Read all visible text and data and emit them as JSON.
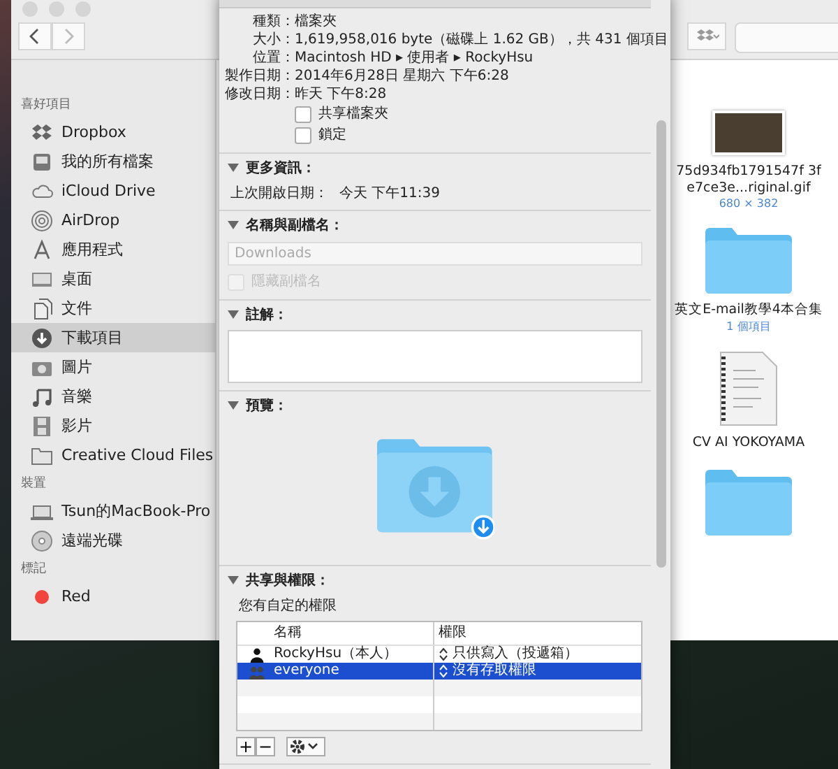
{
  "finder": {
    "sidebar": [
      {
        "heading": "喜好項目",
        "items": [
          {
            "label": "Dropbox",
            "selected": false
          },
          {
            "label": "我的所有檔案",
            "selected": false
          },
          {
            "label": "iCloud Drive",
            "selected": false
          },
          {
            "label": "AirDrop",
            "selected": false
          },
          {
            "label": "應用程式",
            "selected": false
          },
          {
            "label": "桌面",
            "selected": false
          },
          {
            "label": "文件",
            "selected": false
          },
          {
            "label": "下載項目",
            "selected": true
          },
          {
            "label": "圖片",
            "selected": false
          },
          {
            "label": "音樂",
            "selected": false
          },
          {
            "label": "影片",
            "selected": false
          },
          {
            "label": "Creative Cloud Files",
            "selected": false
          }
        ]
      },
      {
        "heading": "裝置",
        "items": [
          {
            "label": "Tsun的MacBook-Pro",
            "selected": false
          },
          {
            "label": "遠端光碟",
            "selected": false
          }
        ]
      },
      {
        "heading": "標記",
        "items": [
          {
            "label": "Red",
            "color": "#f2453d",
            "selected": false
          }
        ]
      }
    ],
    "files": [
      {
        "kind": "image",
        "name": "75d934fb1791547f 3fe7ce3e...riginal.gif",
        "detail": "680 × 382"
      },
      {
        "kind": "folder",
        "name": "英文E-mail教學4本合集",
        "detail": "1 個項目"
      },
      {
        "kind": "document",
        "name": "CV   AI YOKOYAMA"
      },
      {
        "kind": "folder"
      }
    ]
  },
  "info": {
    "general": [
      {
        "label": "種類：",
        "value": "檔案夾"
      },
      {
        "label": "大小：",
        "value": "1,619,958,016 byte（磁碟上 1.62 GB），共 431 個項目"
      },
      {
        "label": "位置：",
        "value": "Macintosh HD ▸ 使用者 ▸ RockyHsu"
      },
      {
        "label": "製作日期：",
        "value": "2014年6月28日 星期六 下午6:28"
      },
      {
        "label": "修改日期：",
        "value": "昨天 下午8:28"
      }
    ],
    "checkboxes": [
      {
        "label": "共享檔案夾",
        "checked": false
      },
      {
        "label": "鎖定",
        "checked": false
      }
    ],
    "sections": [
      {
        "kind": "rows",
        "title": "更多資訊：",
        "expanded": true,
        "rows": [
          {
            "label": "上次開啟日期：",
            "value": "今天 下午11:39"
          }
        ]
      },
      {
        "kind": "name",
        "title": "名稱與副檔名：",
        "expanded": true,
        "placeholder": "Downloads",
        "hide_extension": {
          "label": "隱藏副檔名",
          "checked": false,
          "disabled": true
        }
      },
      {
        "kind": "comments",
        "title": "註解：",
        "expanded": true
      },
      {
        "kind": "preview",
        "title": "預覽：",
        "expanded": true
      },
      {
        "kind": "sharing",
        "title": "共享與權限：",
        "expanded": true,
        "note": "您有自定的權限",
        "columns": [
          "名稱",
          "權限"
        ],
        "rows": [
          {
            "name": "RockyHsu（本人）",
            "privilege": "只供寫入（投遞箱）",
            "kind": "user",
            "selected": false
          },
          {
            "name": "everyone",
            "privilege": "沒有存取權限",
            "kind": "group",
            "selected": true
          }
        ],
        "buttons": [
          "+",
          "−"
        ]
      }
    ]
  }
}
